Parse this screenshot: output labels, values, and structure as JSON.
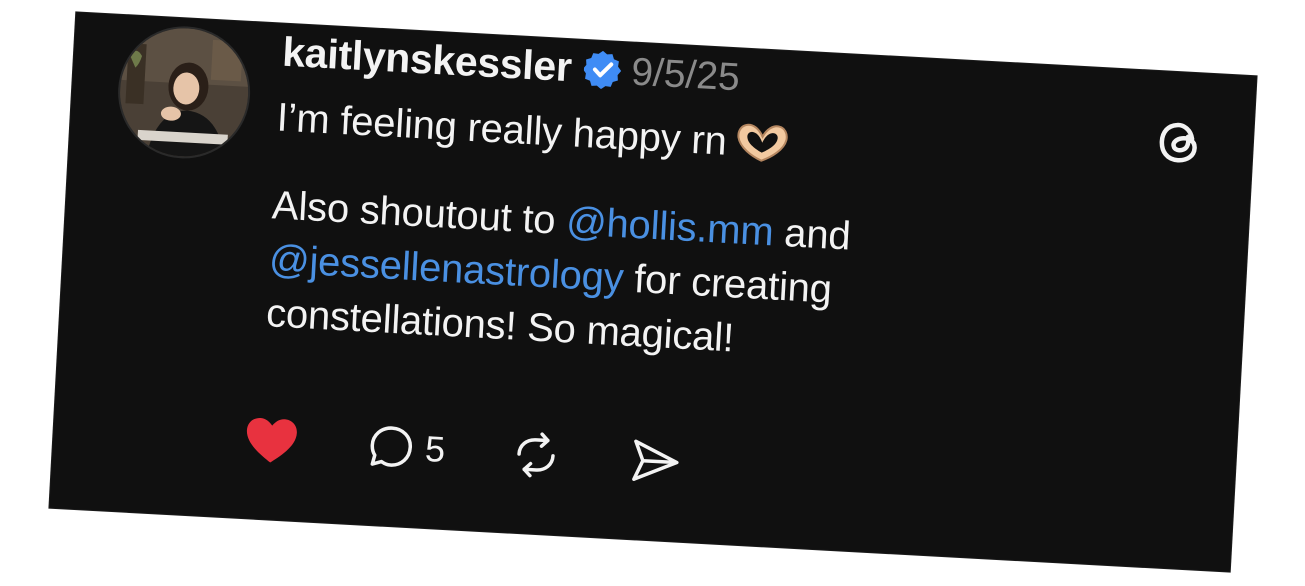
{
  "post": {
    "username": "kaitlynskessler",
    "date": "9/5/25",
    "line1": "I’m feeling really happy rn",
    "line2_a": "Also shoutout to ",
    "mention1": "@hollis.mm",
    "line2_b": " and",
    "mention2": "@jessellenastrology",
    "line3_b": " for creating",
    "line4": "constellations! So magical!"
  },
  "actions": {
    "reply_count": "5"
  },
  "colors": {
    "background": "#101010",
    "text": "#f3f3f3",
    "muted": "#8a8a8a",
    "mention": "#4a90e2",
    "like": "#e8323f",
    "verified": "#3f8cf5"
  },
  "icons": [
    "verified-badge-icon",
    "threads-logo-icon",
    "heart-icon",
    "reply-icon",
    "repost-icon",
    "share-icon",
    "heart-hands-emoji"
  ]
}
